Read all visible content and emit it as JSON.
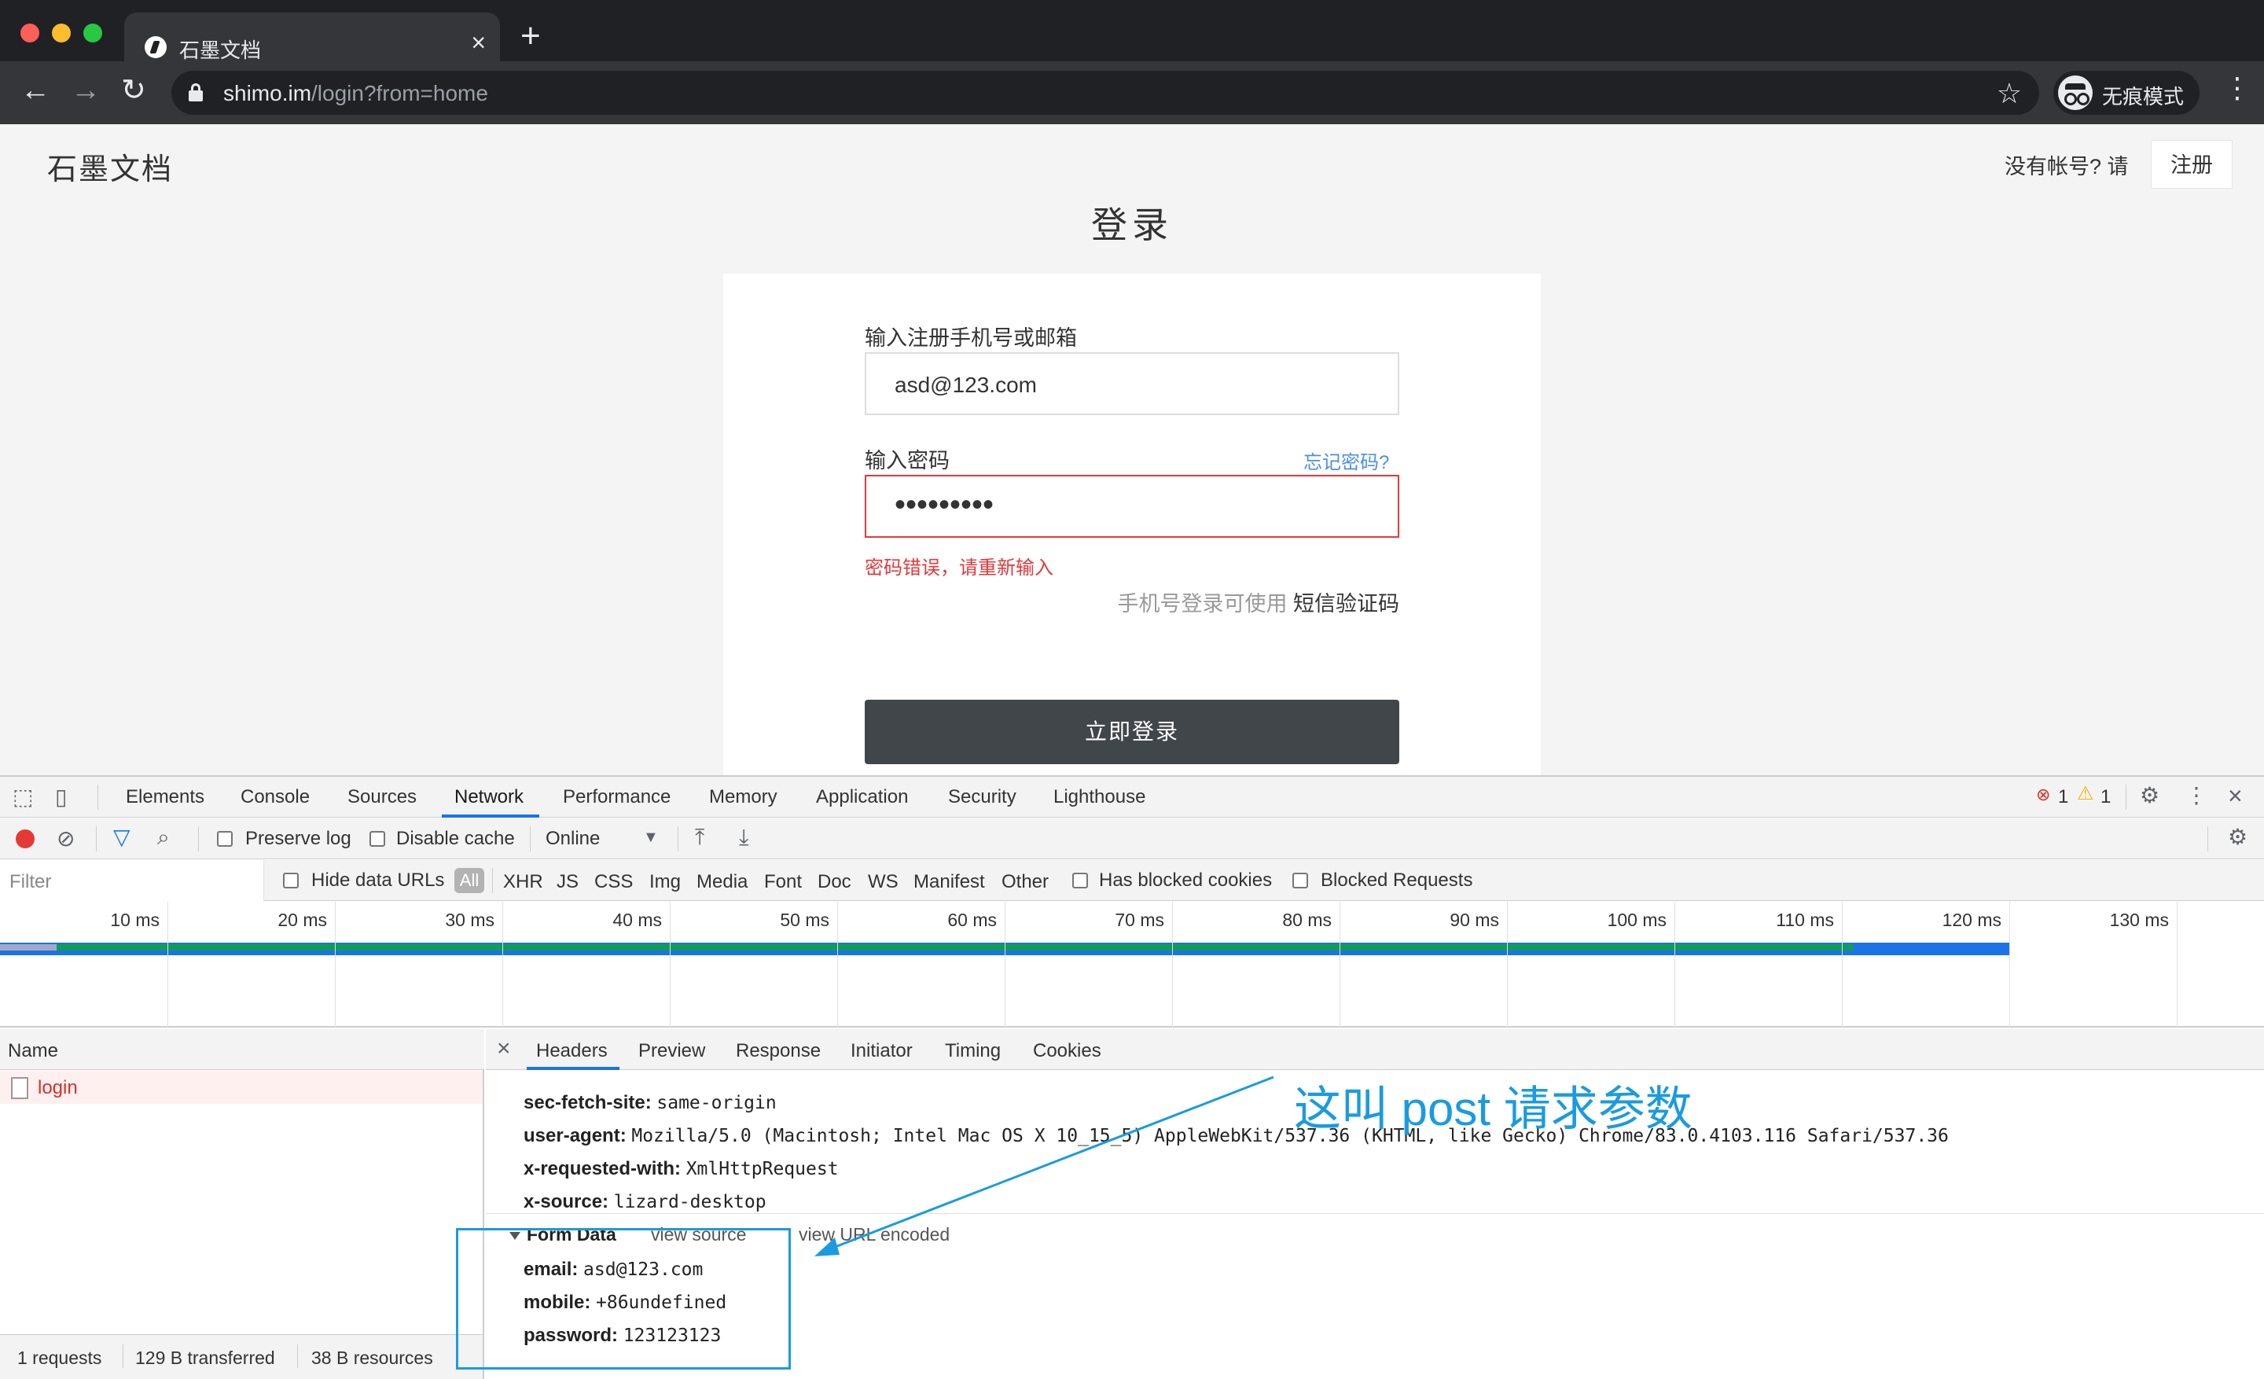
{
  "browser": {
    "tab_title": "石墨文档",
    "url_host": "shimo.im",
    "url_path": "/login?from=home",
    "profile_label": "无痕模式"
  },
  "site": {
    "logo": "石墨文档",
    "no_account": "没有帐号? 请",
    "register": "注册",
    "title": "登录"
  },
  "form": {
    "account_label": "输入注册手机号或邮箱",
    "account_value": "asd@123.com",
    "password_label": "输入密码",
    "forgot": "忘记密码?",
    "password_mask": "•••••••••",
    "error": "密码错误，请重新输入",
    "sms_prefix": "手机号登录可使用",
    "sms_link": "短信验证码",
    "submit": "立即登录"
  },
  "devtools": {
    "tabs": [
      "Elements",
      "Console",
      "Sources",
      "Network",
      "Performance",
      "Memory",
      "Application",
      "Security",
      "Lighthouse"
    ],
    "active_tab": "Network",
    "error_count": "1",
    "warning_count": "1",
    "preserve_log": "Preserve log",
    "disable_cache": "Disable cache",
    "throttle": "Online",
    "filter_placeholder": "Filter",
    "hide_data_urls": "Hide data URLs",
    "all": "All",
    "types": [
      "XHR",
      "JS",
      "CSS",
      "Img",
      "Media",
      "Font",
      "Doc",
      "WS",
      "Manifest",
      "Other"
    ],
    "has_blocked_cookies": "Has blocked cookies",
    "blocked_requests": "Blocked Requests",
    "ticks": [
      "10 ms",
      "20 ms",
      "30 ms",
      "40 ms",
      "50 ms",
      "60 ms",
      "70 ms",
      "80 ms",
      "90 ms",
      "100 ms",
      "110 ms",
      "120 ms",
      "130 ms"
    ],
    "name_header": "Name",
    "request_name": "login",
    "status": [
      "1 requests",
      "129 B transferred",
      "38 B resources"
    ],
    "detail_tabs": [
      "Headers",
      "Preview",
      "Response",
      "Initiator",
      "Timing",
      "Cookies"
    ],
    "headers": [
      {
        "key": "sec-fetch-site:",
        "value": "same-origin"
      },
      {
        "key": "user-agent:",
        "value": "Mozilla/5.0 (Macintosh; Intel Mac OS X 10_15_5) AppleWebKit/537.36 (KHTML, like Gecko) Chrome/83.0.4103.116 Safari/537.36"
      },
      {
        "key": "x-requested-with:",
        "value": "XmlHttpRequest"
      },
      {
        "key": "x-source:",
        "value": "lizard-desktop"
      }
    ],
    "form_data_title": "Form Data",
    "view_source": "view source",
    "view_url_encoded": "view URL encoded",
    "form_data": [
      {
        "key": "email:",
        "value": "asd@123.com"
      },
      {
        "key": "mobile:",
        "value": "+86undefined"
      },
      {
        "key": "password:",
        "value": "123123123"
      }
    ]
  },
  "annotation": {
    "text": "这叫 post 请求参数",
    "color": "#1a9be0"
  }
}
